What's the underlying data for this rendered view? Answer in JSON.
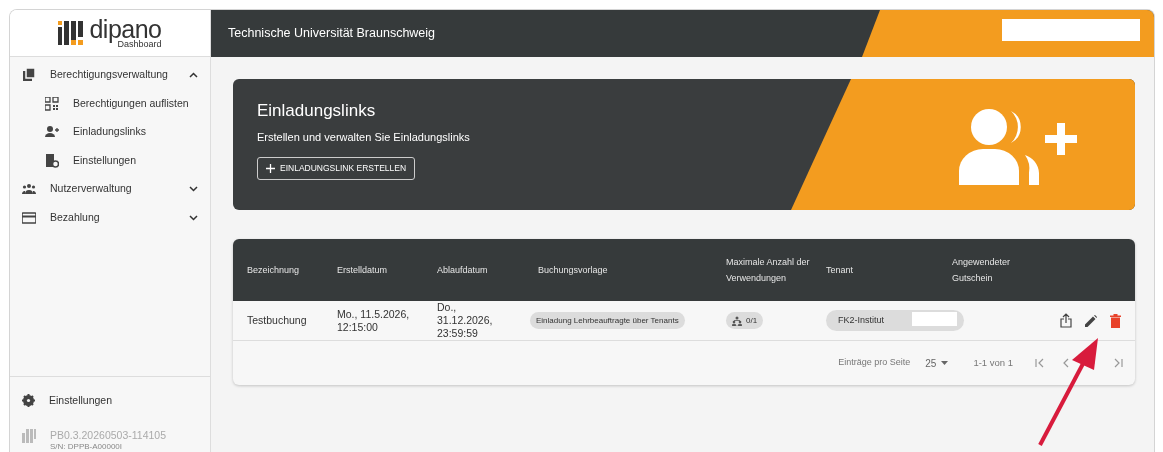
{
  "brand": {
    "name": "dipano",
    "sub": "Dashboard"
  },
  "sidebar": {
    "items": [
      {
        "label": "Berechtigungsverwaltung",
        "expanded": true,
        "children": [
          {
            "label": "Berechtigungen auflisten"
          },
          {
            "label": "Einladungslinks"
          },
          {
            "label": "Einstellungen"
          }
        ]
      },
      {
        "label": "Nutzerverwaltung",
        "expanded": false
      },
      {
        "label": "Bezahlung",
        "expanded": false
      }
    ],
    "footer_item": "Einstellungen",
    "version": "PB0.3.20260503-114105",
    "serial": "S/N: DPPB-A00000I"
  },
  "header": {
    "title": "Technische Universität Braunschweig"
  },
  "hero": {
    "title": "Einladungslinks",
    "subtitle": "Erstellen und verwalten Sie Einladungslinks",
    "button": "EINLADUNGSLINK ERSTELLEN"
  },
  "table": {
    "columns": [
      "Bezeichnung",
      "Erstelldatum",
      "Ablaufdatum",
      "Buchungsvorlage",
      "Maximale Anzahl der Verwendungen",
      "Tenant",
      "Angewendeter Gutschein"
    ],
    "rows": [
      {
        "bezeichnung": "Testbuchung",
        "erstelldatum": "Mo., 11.5.2026, 12:15:00",
        "ablaufdatum": "Do., 31.12.2026, 23:59:59",
        "buchungsvorlage": "Einladung Lehrbeauftragte über Tenants",
        "verwendungen": "0/1",
        "tenant": "FK2-Institut"
      }
    ]
  },
  "pagination": {
    "label": "Einträge pro Seite",
    "page_size": "25",
    "range": "1-1 von 1"
  }
}
